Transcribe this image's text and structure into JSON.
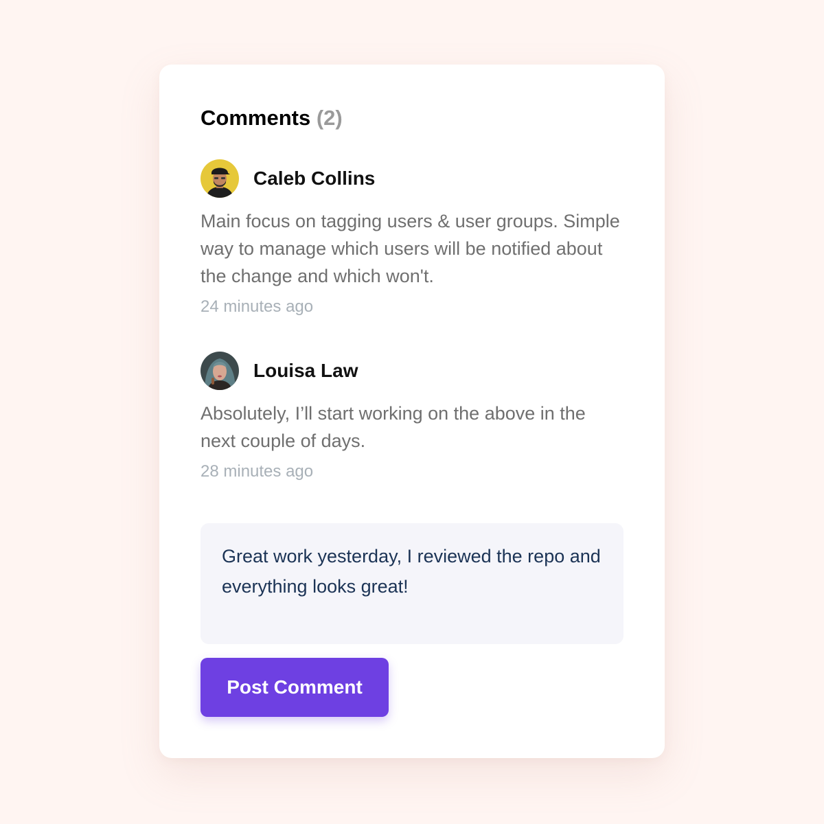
{
  "comments_section": {
    "title": "Comments",
    "count_label": "(2)"
  },
  "comments": [
    {
      "author": "Caleb Collins",
      "avatar": "avatar-caleb-collins",
      "text": "Main focus on tagging users & user groups. Simple way to manage which users will be notified about the change and which won't.",
      "time": "24 minutes ago"
    },
    {
      "author": "Louisa Law",
      "avatar": "avatar-louisa-law",
      "text": "Absolutely, I’ll start working on the above in the next couple of days.",
      "time": "28 minutes ago"
    }
  ],
  "composer": {
    "value": "Great work yesterday, I reviewed the repo and everything looks great!"
  },
  "post_button": {
    "label": "Post Comment"
  },
  "colors": {
    "background": "#FFF5F2",
    "card": "#FFFFFF",
    "accent": "#6E40E2",
    "muted_text": "#6F6F6F",
    "timestamp": "#A8B0B7",
    "composer_text": "#1B3355"
  }
}
